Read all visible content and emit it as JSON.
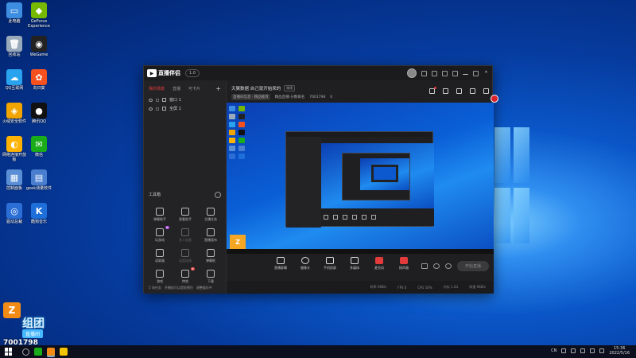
{
  "desktop": {
    "icons": [
      {
        "label": "此电脑",
        "color": "#3d8de0",
        "glyph": "▭"
      },
      {
        "label": "GeForce Experience",
        "color": "#76b900",
        "glyph": "◆"
      },
      {
        "label": "回收站",
        "color": "#9ab",
        "glyph": "🗑"
      },
      {
        "label": "WeGame",
        "color": "#222",
        "glyph": "◉"
      },
      {
        "label": "QQ互联网",
        "color": "#2aa3ef",
        "glyph": "☁"
      },
      {
        "label": "向日葵",
        "color": "#f4511e",
        "glyph": "✿"
      },
      {
        "label": "火绒安全软件",
        "color": "#f2a400",
        "glyph": "◈"
      },
      {
        "label": "腾讯QQ",
        "color": "#111",
        "glyph": "●"
      },
      {
        "label": "网络连接开放板",
        "color": "#ffb300",
        "glyph": "◐"
      },
      {
        "label": "微信",
        "color": "#1aad19",
        "glyph": "✉"
      },
      {
        "label": "控制面板",
        "color": "#5a8fd6",
        "glyph": "▦"
      },
      {
        "label": "geek测量软件",
        "color": "#4a7fd0",
        "glyph": "▤"
      },
      {
        "label": "驱动总裁",
        "color": "#2b6fd6",
        "glyph": "◎"
      },
      {
        "label": "酷狗音乐",
        "color": "#1e6fd9",
        "glyph": "K"
      }
    ]
  },
  "app": {
    "logo": "直播伴侣",
    "version": "1.0",
    "left_tabs": [
      "我的场景",
      "直播",
      "可卡片"
    ],
    "add": "+",
    "scenes": [
      "窗口 1",
      "全屏 1"
    ],
    "toolbox_title": "工具箱",
    "tools": [
      {
        "label": "弹幕助手",
        "badge": ""
      },
      {
        "label": "观看助手",
        "badge": ""
      },
      {
        "label": "主播任务",
        "badge": ""
      },
      {
        "label": "玩游戏",
        "badge": "新"
      },
      {
        "label": "多人连麦",
        "badge": ""
      },
      {
        "label": "直播画布",
        "badge": ""
      },
      {
        "label": "读屏器",
        "badge": ""
      },
      {
        "label": "远程连线",
        "badge": ""
      },
      {
        "label": "弹幕框",
        "badge": ""
      },
      {
        "label": "游戏",
        "badge": ""
      },
      {
        "label": "特效",
        "badge": "新"
      },
      {
        "label": "下载",
        "badge": ""
      }
    ],
    "left_status": [
      "5 场任务",
      "开播前可以提前预约",
      "调整缓存中"
    ],
    "room_title": "天翼数据 自己就开始来的",
    "room_tag": "修改",
    "room_sub": [
      "直播间信息 · 精品推荐",
      "精品直播·分数排名",
      "7001798",
      "0"
    ],
    "controls": [
      {
        "label": "直播屏幕",
        "shape": "rect"
      },
      {
        "label": "摄像头",
        "shape": "round"
      },
      {
        "label": "手机投屏",
        "shape": "rect"
      },
      {
        "label": "多媒体",
        "shape": "rect"
      },
      {
        "label": "麦克风",
        "shape": "red"
      },
      {
        "label": "扬声器",
        "shape": "red"
      }
    ],
    "start_label": "开始直播",
    "stats": [
      "码率 0KB/s",
      "FPS 0",
      "CPU 16%",
      "内存 1.2G",
      "网速 0KB/s"
    ]
  },
  "overlay": {
    "logo": "Z",
    "name": "组团",
    "button": "直播间",
    "room_id": "7001798"
  },
  "taskbar": {
    "tray_lang": "CN",
    "time": "15:36",
    "date": "2022/5/16"
  }
}
